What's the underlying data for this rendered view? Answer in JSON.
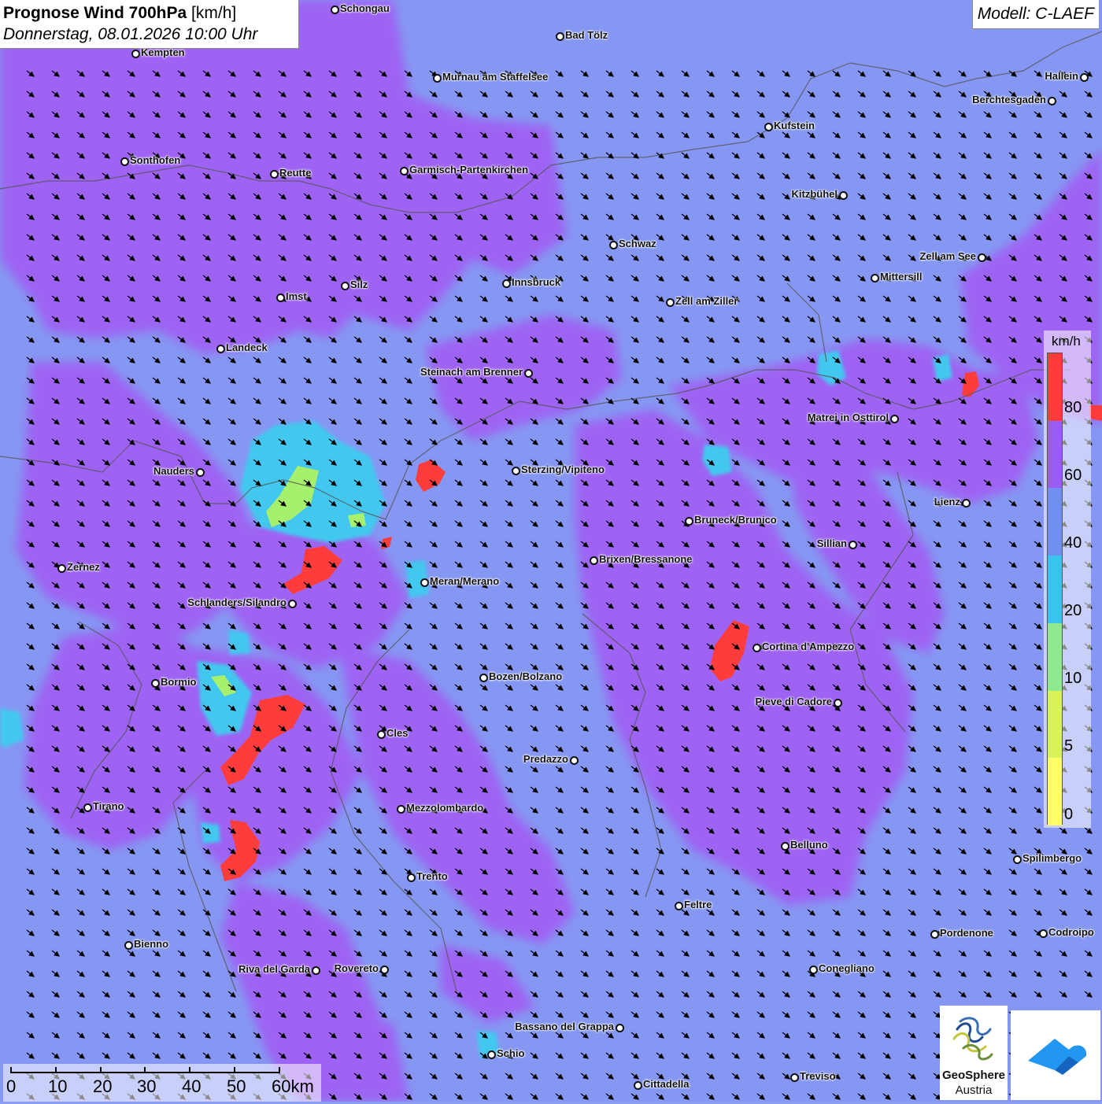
{
  "title": {
    "main": "Prognose Wind 700hPa",
    "unit": "[km/h]",
    "datetime": "Donnerstag, 08.01.2026 10:00 Uhr"
  },
  "model": "Modell: C-LAEF",
  "legend": {
    "unit": "km/h",
    "ticks": [
      "80",
      "60",
      "40",
      "20",
      "10",
      "5",
      "0"
    ],
    "colors": [
      "#ff3b3b",
      "#9b5cf5",
      "#6f8ff3",
      "#38c4ef",
      "#8fe98f",
      "#d8f25a",
      "#ffff66"
    ]
  },
  "cities": [
    {
      "name": "Schongau",
      "dot": "left"
    },
    {
      "name": "Bad Tölz",
      "dot": "left"
    },
    {
      "name": "Kempten",
      "dot": "left"
    },
    {
      "name": "Murnau am Staffelsee",
      "dot": "left"
    },
    {
      "name": "Hallein",
      "dot": "right"
    },
    {
      "name": "Berchtesgaden",
      "dot": "right"
    },
    {
      "name": "Kufstein",
      "dot": "left"
    },
    {
      "name": "Sonthofen",
      "dot": "left"
    },
    {
      "name": "Reutte",
      "dot": "left"
    },
    {
      "name": "Garmisch-Partenkirchen",
      "dot": "left"
    },
    {
      "name": "Kitzbühel",
      "dot": "right"
    },
    {
      "name": "Schwaz",
      "dot": "left"
    },
    {
      "name": "Zell am See",
      "dot": "right"
    },
    {
      "name": "Mittersill",
      "dot": "left"
    },
    {
      "name": "Silz",
      "dot": "left"
    },
    {
      "name": "Innsbruck",
      "dot": "left"
    },
    {
      "name": "Imst",
      "dot": "left"
    },
    {
      "name": "Zell am Ziller",
      "dot": "left"
    },
    {
      "name": "Landeck",
      "dot": "left"
    },
    {
      "name": "Steinach am Brenner",
      "dot": "right"
    },
    {
      "name": "Matrei in Osttirol",
      "dot": "right"
    },
    {
      "name": "Nauders",
      "dot": "right"
    },
    {
      "name": "Sterzing/Vipiteno",
      "dot": "left"
    },
    {
      "name": "Lienz",
      "dot": "right"
    },
    {
      "name": "Bruneck/Brunico",
      "dot": "left"
    },
    {
      "name": "Sillian",
      "dot": "right"
    },
    {
      "name": "Zernez",
      "dot": "left"
    },
    {
      "name": "Brixen/Bressanone",
      "dot": "left"
    },
    {
      "name": "Meran/Merano",
      "dot": "left"
    },
    {
      "name": "Schlanders/Silandro",
      "dot": "right"
    },
    {
      "name": "Cortina d'Ampezzo",
      "dot": "left"
    },
    {
      "name": "Bozen/Bolzano",
      "dot": "left"
    },
    {
      "name": "Bormio",
      "dot": "left"
    },
    {
      "name": "Pieve di Cadore",
      "dot": "right"
    },
    {
      "name": "Cles",
      "dot": "left"
    },
    {
      "name": "Predazzo",
      "dot": "right"
    },
    {
      "name": "Tirano",
      "dot": "left"
    },
    {
      "name": "Mezzolombardo",
      "dot": "left"
    },
    {
      "name": "Belluno",
      "dot": "left"
    },
    {
      "name": "Spilimbergo",
      "dot": "left"
    },
    {
      "name": "Trento",
      "dot": "left"
    },
    {
      "name": "Feltre",
      "dot": "left"
    },
    {
      "name": "Pordenone",
      "dot": "left"
    },
    {
      "name": "Codroipo",
      "dot": "left"
    },
    {
      "name": "Bienno",
      "dot": "left"
    },
    {
      "name": "Riva del Garda",
      "dot": "right"
    },
    {
      "name": "Rovereto",
      "dot": "right"
    },
    {
      "name": "Conegliano",
      "dot": "left"
    },
    {
      "name": "Bassano del Grappa",
      "dot": "right"
    },
    {
      "name": "Schio",
      "dot": "left"
    },
    {
      "name": "Treviso",
      "dot": "left"
    },
    {
      "name": "Cittadella",
      "dot": "left"
    }
  ],
  "scale": {
    "labels": [
      "0",
      "10",
      "20",
      "30",
      "40",
      "50",
      "60km"
    ]
  },
  "logo": {
    "geosphere_line1": "GeoSphere",
    "geosphere_line2": "Austria"
  },
  "wind": {
    "direction": "northwest",
    "arrow_color": "#000000"
  }
}
